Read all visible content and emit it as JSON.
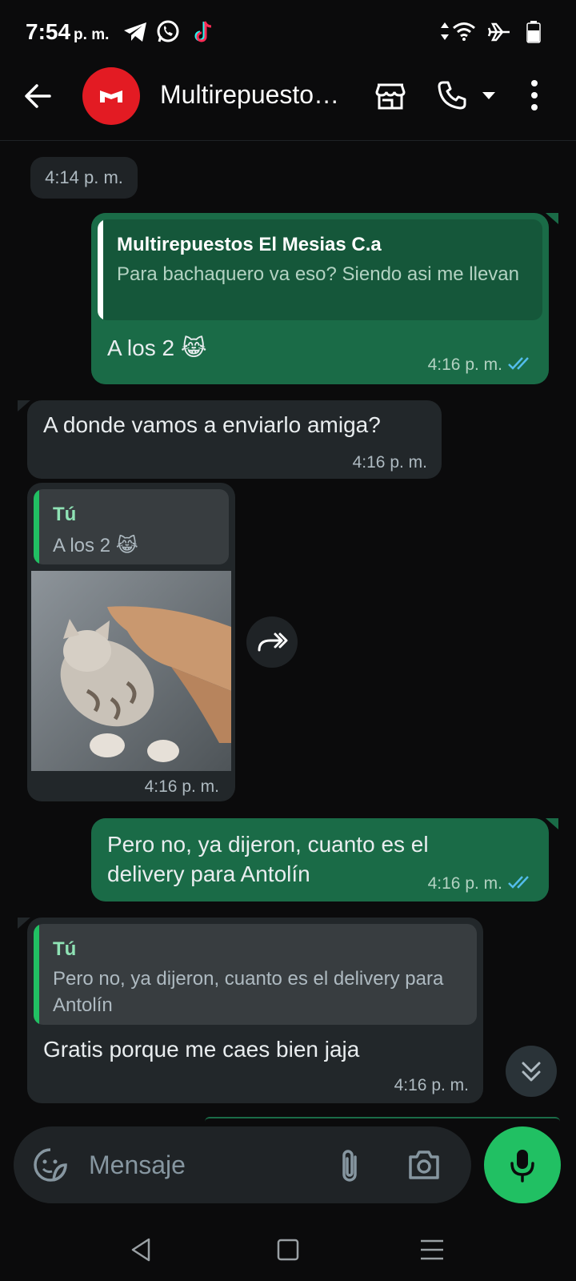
{
  "status_bar": {
    "time": "7:54",
    "ampm": "p. m.",
    "notification_icons": [
      "telegram-icon",
      "whatsapp-icon",
      "tiktok-icon"
    ],
    "system_icons": [
      "data-arrows-icon",
      "wifi-icon",
      "airplane-icon",
      "battery-icon"
    ]
  },
  "header": {
    "chat_name": "Multirepuesto…",
    "icons": [
      "back-arrow-icon",
      "store-icon",
      "phone-icon",
      "dropdown-caret-icon",
      "more-vert-icon"
    ]
  },
  "messages": {
    "date_chip": "4:14 p. m.",
    "m1": {
      "direction": "outgoing",
      "quote_name": "Multirepuestos El Mesias C.a",
      "quote_text": "Para bachaquero va eso? Siendo asi me llevan",
      "text": "A los 2 😹",
      "time": "4:16 p. m.",
      "status": "read"
    },
    "m2": {
      "direction": "incoming",
      "text": "A donde vamos a enviarlo amiga?",
      "time": "4:16 p. m."
    },
    "m3": {
      "direction": "incoming",
      "quote_name": "Tú",
      "quote_text": "A los 2 😹",
      "media": "photo",
      "time": "4:16 p. m."
    },
    "m4": {
      "direction": "outgoing",
      "text": "Pero no, ya dijeron, cuanto es el delivery para Antolín",
      "time": "4:16 p. m.",
      "status": "read"
    },
    "m5": {
      "direction": "incoming",
      "quote_name": "Tú",
      "quote_text": "Pero no, ya dijeron, cuanto es el delivery para Antolín",
      "text": "Gratis porque me caes bien jaja",
      "time": "4:16 p. m."
    }
  },
  "composer": {
    "placeholder": "Mensaje",
    "icons": [
      "sticker-icon",
      "attach-icon",
      "camera-icon",
      "mic-icon"
    ]
  },
  "colors": {
    "background": "#0b0b0c",
    "outgoing_bubble": "#1a6b47",
    "incoming_bubble": "#22272a",
    "accent_green": "#21c063",
    "quote_name_own": "#53bdeb",
    "quote_name_contact": "#8fe3b5",
    "read_ticks": "#53bdeb"
  }
}
